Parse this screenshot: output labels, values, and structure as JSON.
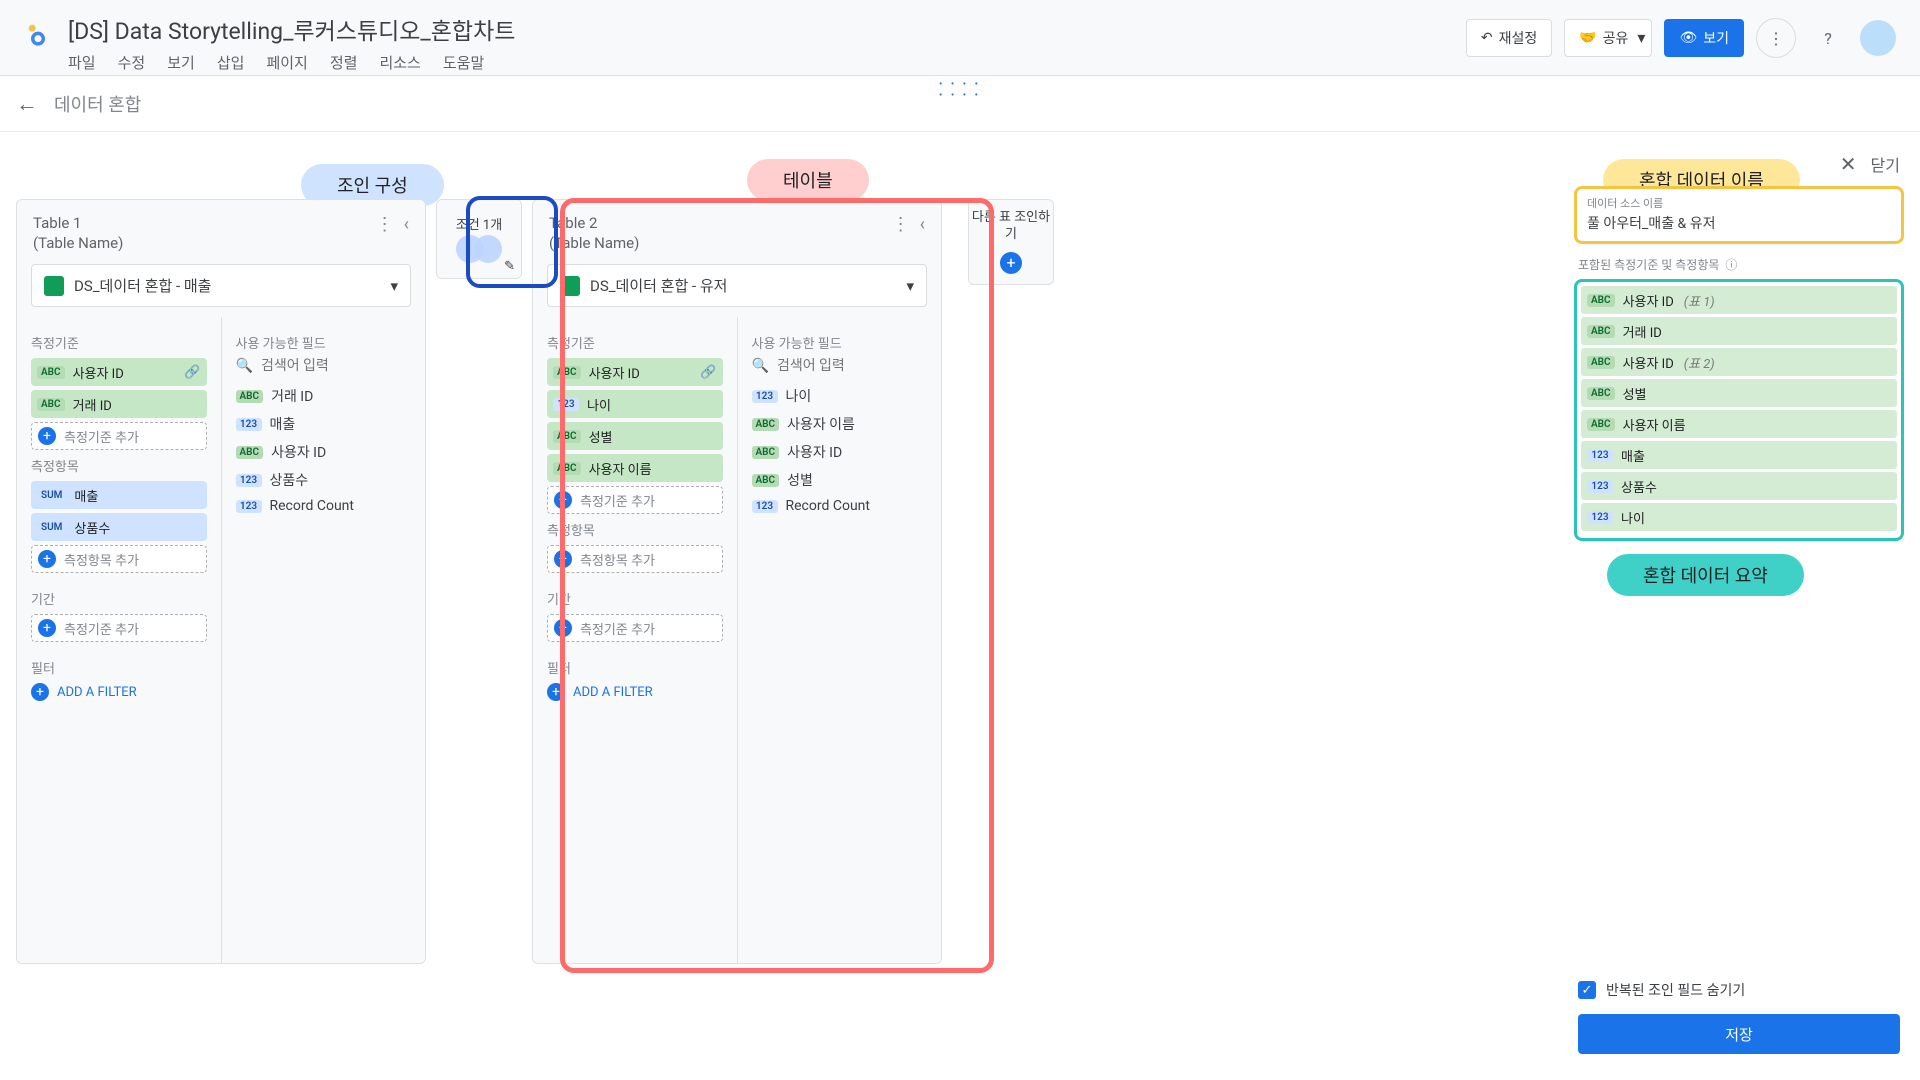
{
  "app": {
    "title": "[DS] Data Storytelling_루커스튜디오_혼합차트",
    "menu": [
      "파일",
      "수정",
      "보기",
      "삽입",
      "페이지",
      "정렬",
      "리소스",
      "도움말"
    ]
  },
  "topbuttons": {
    "reset": "재설정",
    "share": "공유",
    "view": "보기"
  },
  "subbar": {
    "title": "데이터 혼합",
    "close": "닫기"
  },
  "pills": {
    "join_config": "조인 구성",
    "table": "테이블",
    "blend_name": "혼합 데이터 이름",
    "blend_summary": "혼합 데이터 요약"
  },
  "table1": {
    "idx": "Table 1",
    "name": "(Table Name)",
    "source": "DS_데이터 혼합 - 매출",
    "labels": {
      "dims": "측정기준",
      "avail": "사용 가능한 필드",
      "search": "검색어 입력",
      "metrics": "측정항목",
      "addDim": "측정기준 추가",
      "addMetric": "측정항목 추가",
      "period": "기간",
      "filter": "필터",
      "addFilter": "ADD A FILTER"
    },
    "dims": [
      {
        "t": "ABC",
        "n": "사용자 ID",
        "link": true
      },
      {
        "t": "ABC",
        "n": "거래 ID"
      }
    ],
    "metrics": [
      {
        "t": "SUM",
        "n": "매출"
      },
      {
        "t": "SUM",
        "n": "상품수"
      }
    ],
    "avail": [
      {
        "t": "ABC",
        "n": "거래 ID"
      },
      {
        "t": "123",
        "n": "매출"
      },
      {
        "t": "ABC",
        "n": "사용자 ID"
      },
      {
        "t": "123",
        "n": "상품수"
      },
      {
        "t": "123",
        "n": "Record Count"
      }
    ]
  },
  "join": {
    "label": "조건 1개"
  },
  "table2": {
    "idx": "Table 2",
    "name": "(Table Name)",
    "source": "DS_데이터 혼합 - 유저",
    "labels": {
      "dims": "측정기준",
      "avail": "사용 가능한 필드",
      "search": "검색어 입력",
      "metrics": "측정항목",
      "addDim": "측정기준 추가",
      "addMetric": "측정항목 추가",
      "period": "기간",
      "filter": "필터",
      "addFilter": "ADD A FILTER"
    },
    "dims": [
      {
        "t": "ABC",
        "n": "사용자 ID",
        "link": true
      },
      {
        "t": "123",
        "n": "나이"
      },
      {
        "t": "ABC",
        "n": "성별"
      },
      {
        "t": "ABC",
        "n": "사용자 이름"
      }
    ],
    "avail": [
      {
        "t": "123",
        "n": "나이"
      },
      {
        "t": "ABC",
        "n": "사용자 이름"
      },
      {
        "t": "ABC",
        "n": "사용자 ID"
      },
      {
        "t": "ABC",
        "n": "성별"
      },
      {
        "t": "123",
        "n": "Record Count"
      }
    ]
  },
  "addJoin": {
    "label": "다른 표 조인하기"
  },
  "blend": {
    "srcLabel": "데이터 소스 이름",
    "srcName": "풀 아우터_매출 & 유저",
    "includedLabel": "포함된 측정기준 및 측정항목",
    "fields": [
      {
        "t": "ABC",
        "n": "사용자 ID",
        "suf": "(표 1)"
      },
      {
        "t": "ABC",
        "n": "거래 ID"
      },
      {
        "t": "ABC",
        "n": "사용자 ID",
        "suf": "(표 2)"
      },
      {
        "t": "ABC",
        "n": "성별"
      },
      {
        "t": "ABC",
        "n": "사용자 이름"
      },
      {
        "t": "123",
        "n": "매출"
      },
      {
        "t": "123",
        "n": "상품수"
      },
      {
        "t": "123",
        "n": "나이"
      }
    ],
    "hideRepeated": "반복된 조인 필드 숨기기",
    "save": "저장"
  }
}
